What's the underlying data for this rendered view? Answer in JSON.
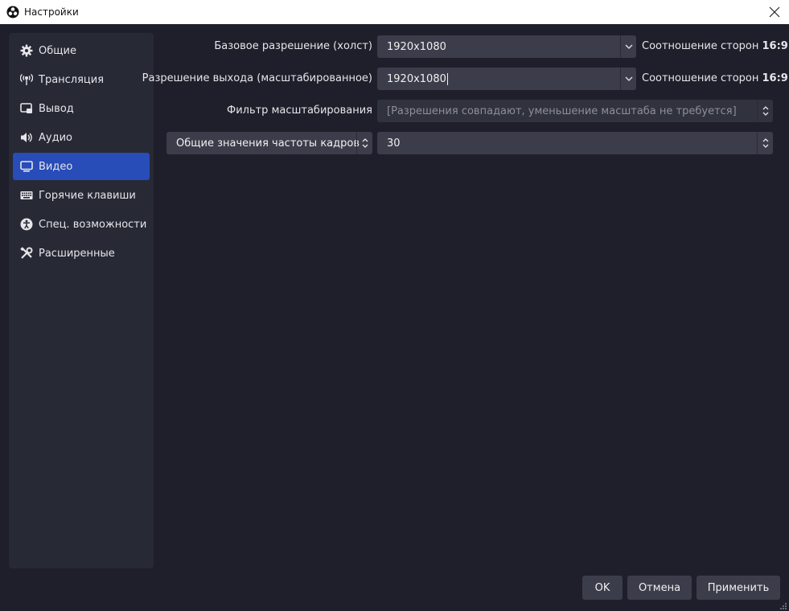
{
  "window": {
    "title": "Настройки"
  },
  "sidebar": {
    "items": [
      {
        "label": "Общие",
        "icon": "gear-icon"
      },
      {
        "label": "Трансляция",
        "icon": "antenna-icon"
      },
      {
        "label": "Вывод",
        "icon": "output-icon"
      },
      {
        "label": "Аудио",
        "icon": "speaker-icon"
      },
      {
        "label": "Видео",
        "icon": "monitor-icon",
        "active": true
      },
      {
        "label": "Горячие клавиши",
        "icon": "keyboard-icon"
      },
      {
        "label": "Спец. возможности",
        "icon": "accessibility-icon"
      },
      {
        "label": "Расширенные",
        "icon": "tools-icon"
      }
    ]
  },
  "video": {
    "base_resolution": {
      "label": "Базовое разрешение (холст)",
      "value": "1920x1080",
      "aspect_label": "Соотношение сторон",
      "aspect_value": "16:9"
    },
    "output_resolution": {
      "label": "Разрешение выхода (масштабированное)",
      "value": "1920x1080",
      "aspect_label": "Соотношение сторон",
      "aspect_value": "16:9"
    },
    "scale_filter": {
      "label": "Фильтр масштабирования",
      "value": "[Разрешения совпадают, уменьшение масштаба не требуется]"
    },
    "fps": {
      "type_value": "Общие значения частоты кадров",
      "value": "30"
    }
  },
  "buttons": {
    "ok": "OK",
    "cancel": "Отмена",
    "apply": "Применить"
  },
  "colors": {
    "background": "#1e1f2a",
    "sidebar": "#272935",
    "active_item": "#284cb8",
    "field": "#3b3d4a"
  }
}
